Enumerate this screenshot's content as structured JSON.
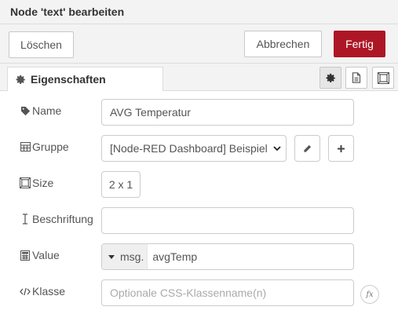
{
  "header": {
    "title": "Node 'text' bearbeiten"
  },
  "toolbar": {
    "delete_label": "Löschen",
    "cancel_label": "Abbrechen",
    "done_label": "Fertig"
  },
  "tabs": {
    "properties_label": "Eigenschaften"
  },
  "form": {
    "name": {
      "label": "Name",
      "value": "AVG Temperatur"
    },
    "group": {
      "label": "Gruppe",
      "value": "[Node-RED Dashboard] Beispiel"
    },
    "size": {
      "label": "Size",
      "value": "2 x 1"
    },
    "caption": {
      "label": "Beschriftung",
      "value": ""
    },
    "value": {
      "label": "Value",
      "type": "msg.",
      "value": "avgTemp"
    },
    "class": {
      "label": "Klasse",
      "placeholder": "Optionale CSS-Klassenname(n)",
      "fx_label": "fx"
    }
  },
  "colors": {
    "accent": "#ad1625",
    "header_bg": "#f3f3f3",
    "border": "#cccccc"
  }
}
